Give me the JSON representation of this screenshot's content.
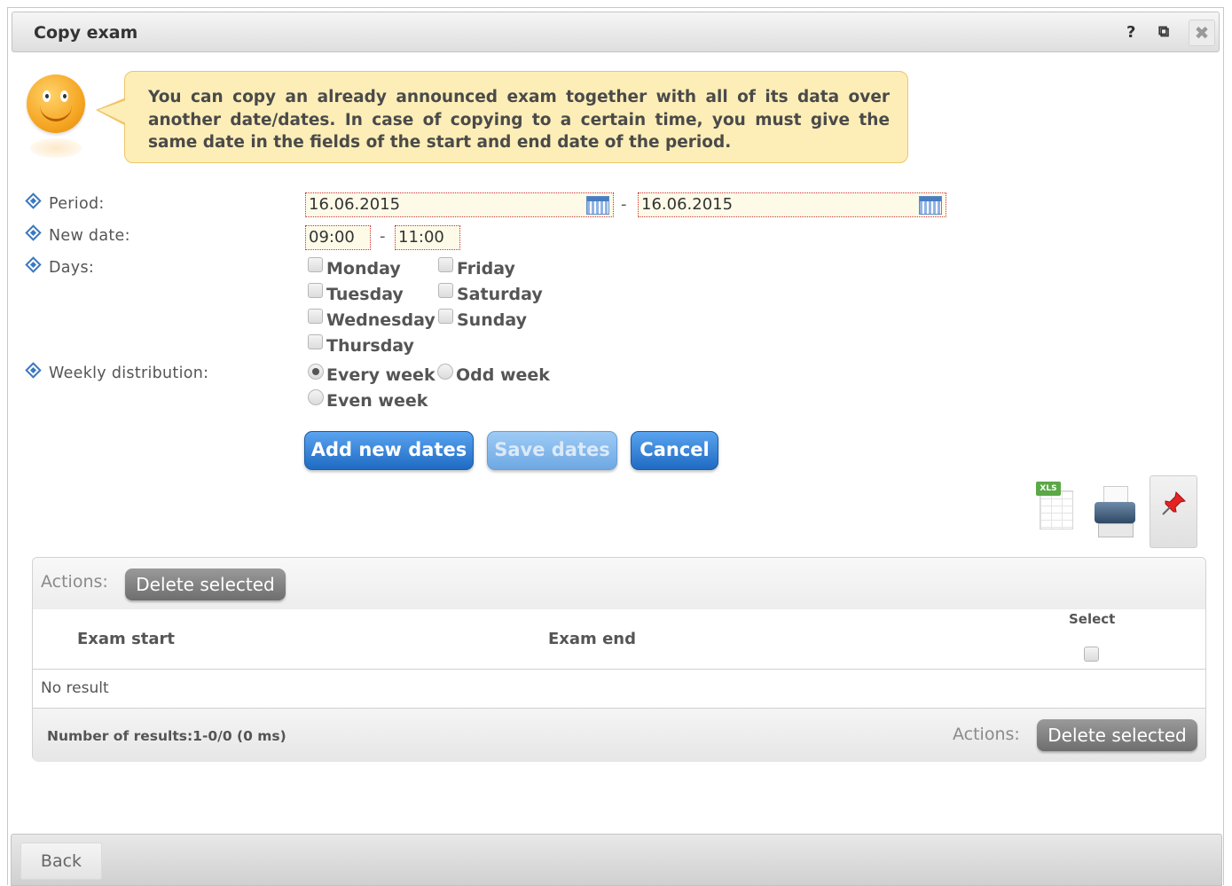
{
  "window": {
    "title": "Copy exam",
    "help": "?",
    "popout": "⧉",
    "close": "✖"
  },
  "info": {
    "text": "You can copy an already announced exam together with all of its data over another date/dates. In case of copying to a certain time, you must give the same date in the fields of the start and end date of the period."
  },
  "form": {
    "period_label": "Period:",
    "period_start": "16.06.2015",
    "period_end": "16.06.2015",
    "newdate_label": "New date:",
    "time_start": "09:00",
    "time_end": "11:00",
    "days_label": "Days:",
    "days": [
      "Monday",
      "Tuesday",
      "Wednesday",
      "Thursday",
      "Friday",
      "Saturday",
      "Sunday"
    ],
    "weekly_label": "Weekly distribution:",
    "weekly_options": [
      "Every week",
      "Odd week",
      "Even week"
    ],
    "weekly_selected": "Every week",
    "separator": "-"
  },
  "buttons": {
    "add": "Add new dates",
    "save": "Save dates",
    "cancel": "Cancel"
  },
  "tools": {
    "xls_tag": "XLS"
  },
  "table": {
    "actions_label": "Actions:",
    "delete_selected": "Delete selected",
    "col_start": "Exam start",
    "col_end": "Exam end",
    "col_select": "Select",
    "no_result": "No result",
    "count": "Number of results:1-0/0 (0 ms)"
  },
  "footer": {
    "back": "Back"
  },
  "colors": {
    "accent_blue": "#1f6bc3",
    "bubble_bg": "#fdeeb7",
    "invalid_border": "#d03030"
  }
}
